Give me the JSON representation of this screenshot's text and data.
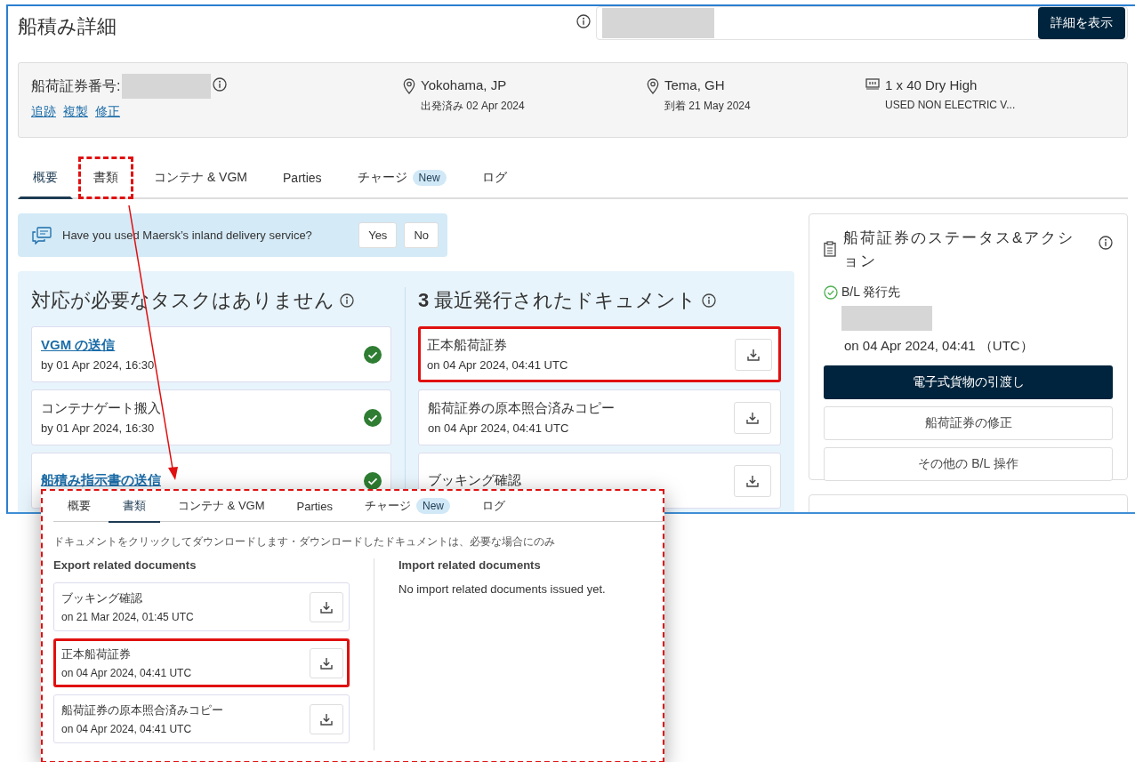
{
  "header": {
    "title": "船積み詳細",
    "view_button": "詳細を表示"
  },
  "summary": {
    "bl_label": "船荷証券番号:",
    "links": [
      "追跡",
      "複製",
      "修正"
    ],
    "places": [
      {
        "kind": "origin",
        "place": "Yokohama, JP",
        "detail": "出発済み 02 Apr 2024"
      },
      {
        "kind": "destination",
        "place": "Tema, GH",
        "detail": "到着 21 May 2024"
      },
      {
        "kind": "cargo",
        "place": "1 x 40 Dry High",
        "detail": "USED NON ELECTRIC V..."
      }
    ]
  },
  "tabs": [
    {
      "label": "概要",
      "selected": true,
      "highlighted": false
    },
    {
      "label": "書類",
      "selected": false,
      "highlighted": true
    },
    {
      "label": "コンテナ & VGM",
      "selected": false,
      "highlighted": false
    },
    {
      "label": "Parties",
      "selected": false,
      "highlighted": false
    },
    {
      "label": "チャージ",
      "badge": "New",
      "selected": false,
      "highlighted": false
    },
    {
      "label": "ログ",
      "selected": false,
      "highlighted": false
    }
  ],
  "banner": {
    "text": "Have you used Maersk’s inland delivery service?",
    "buttons": [
      "Yes",
      "No"
    ]
  },
  "tasks": {
    "heading": "対応が必要なタスクはありません",
    "items": [
      {
        "title": "VGM の送信",
        "kind": "link",
        "due": "by 01 Apr 2024, 16:30",
        "done": true
      },
      {
        "title": "コンテナゲート搬入",
        "kind": "plain",
        "due": "by 01 Apr 2024, 16:30",
        "done": true
      },
      {
        "title": "船積み指示書の送信",
        "kind": "link",
        "done": true
      }
    ]
  },
  "recent_docs": {
    "count": "3",
    "heading": "最近発行されたドキュメント",
    "docs": [
      {
        "name": "正本船荷証券",
        "date": "on 04 Apr 2024, 04:41 UTC",
        "highlighted": true
      },
      {
        "name": "船荷証券の原本照合済みコピー",
        "date": "on 04 Apr 2024, 04:41 UTC",
        "highlighted": false
      },
      {
        "name": "ブッキング確認",
        "highlighted": false
      }
    ]
  },
  "bl_status": {
    "title": "船荷証券のステータス&アクション",
    "status": "B/L 発行先",
    "date": "on 04 Apr 2024, 04:41 （UTC）",
    "buttons": [
      {
        "label": "電子式貨物の引渡し",
        "kind": "primary"
      },
      {
        "label": "船荷証券の修正",
        "kind": "secondary"
      },
      {
        "label": "その他の B/L 操作",
        "kind": "secondary"
      }
    ]
  },
  "callout": {
    "tabs": [
      {
        "label": "概要",
        "selected": false
      },
      {
        "label": "書類",
        "selected": true
      },
      {
        "label": "コンテナ & VGM",
        "selected": false
      },
      {
        "label": "Parties",
        "selected": false
      },
      {
        "label": "チャージ",
        "badge": "New",
        "selected": false
      },
      {
        "label": "ログ",
        "selected": false
      }
    ],
    "note": "ドキュメントをクリックしてダウンロードします・ダウンロードしたドキュメントは、必要な場合にのみ",
    "export": {
      "heading": "Export related documents",
      "docs": [
        {
          "name": "ブッキング確認",
          "date": "on 21 Mar 2024, 01:45 UTC",
          "highlighted": false
        },
        {
          "name": "正本船荷証券",
          "date": "on 04 Apr 2024, 04:41 UTC",
          "highlighted": true
        },
        {
          "name": "船荷証券の原本照合済みコピー",
          "date": "on 04 Apr 2024, 04:41 UTC",
          "highlighted": false
        }
      ]
    },
    "import": {
      "heading": "Import related documents",
      "empty": "No import related documents issued yet."
    }
  }
}
